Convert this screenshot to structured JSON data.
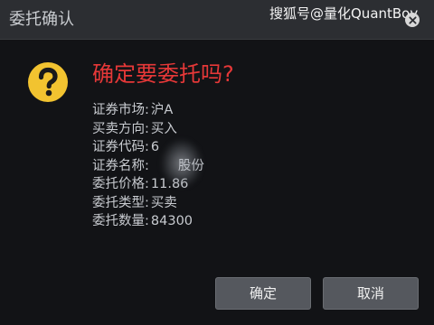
{
  "window": {
    "title": "委托确认",
    "watermark": "搜狐号@量化QuantBoy"
  },
  "prompt": {
    "question": "确定要委托吗?"
  },
  "details": [
    {
      "label": "证券市场:",
      "value": "沪A"
    },
    {
      "label": "买卖方向:",
      "value": "买入"
    },
    {
      "label": "证券代码:",
      "value": "6"
    },
    {
      "label": "证券名称:",
      "value": "股份"
    },
    {
      "label": "委托价格:",
      "value": "11.86"
    },
    {
      "label": "委托类型:",
      "value": "买卖"
    },
    {
      "label": "委托数量:",
      "value": "84300"
    }
  ],
  "buttons": {
    "ok": "确定",
    "cancel": "取消"
  },
  "icons": {
    "question": "question-mark-icon",
    "close": "close-icon"
  },
  "colors": {
    "question_text": "#e63838",
    "icon_fill": "#f2c330"
  }
}
